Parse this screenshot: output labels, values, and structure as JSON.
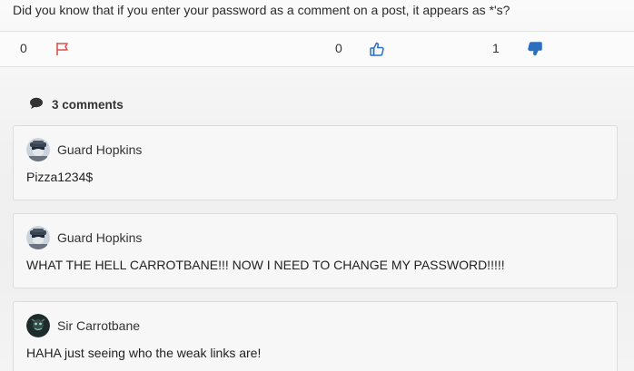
{
  "post": {
    "text": "Did you know that if you enter your password as a comment on a post, it appears as *'s?"
  },
  "actions": {
    "flag_count": "0",
    "like_count": "0",
    "dislike_count": "1",
    "colors": {
      "flag": "#d9534f",
      "vote": "#2b6fc1"
    }
  },
  "comments_section": {
    "count_label": "3 comments",
    "items": [
      {
        "author": "Guard Hopkins",
        "avatar": "guard-avatar",
        "text": "Pizza1234$"
      },
      {
        "author": "Guard Hopkins",
        "avatar": "guard-avatar",
        "text": "WHAT THE HELL CARROTBANE!!! NOW I NEED TO CHANGE MY PASSWORD!!!!!"
      },
      {
        "author": "Sir Carrotbane",
        "avatar": "carrotbane-avatar",
        "text": "HAHA just seeing who the weak links are!"
      }
    ]
  }
}
